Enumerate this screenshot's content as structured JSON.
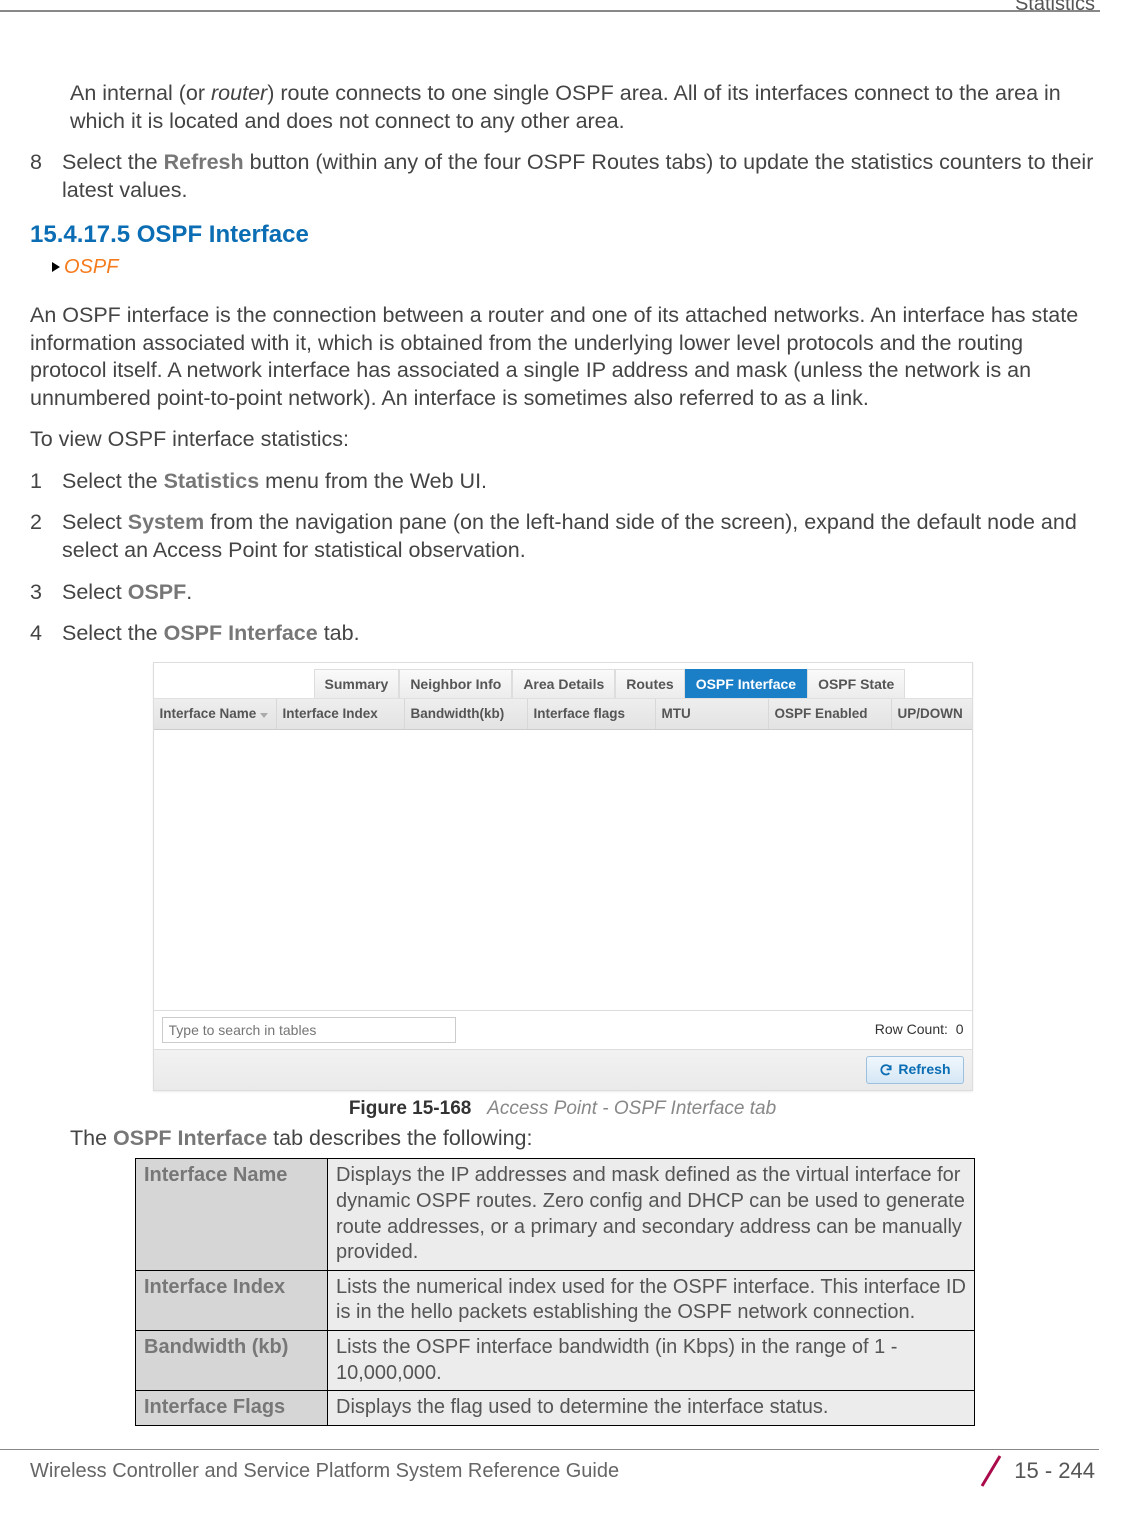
{
  "header": {
    "section": "Statistics"
  },
  "intro": {
    "p1": "An internal (or router) route connects to one single OSPF area. All of its interfaces connect to the area in which it is located and does not connect to any other area."
  },
  "step8": {
    "n": "8",
    "pre": "Select the ",
    "btn": "Refresh",
    "post": " button (within any of the four OSPF Routes tabs) to update the statistics counters to their latest values."
  },
  "h2": "15.4.17.5  OSPF Interface",
  "crumb": "OSPF",
  "p2": "An OSPF interface is the connection between a router and one of its attached networks. An interface has state information associated with it, which is obtained from the underlying lower level protocols and the routing protocol itself. A network interface has associated a single IP address and mask (unless the network is an unnumbered point-to-point network). An interface is sometimes also referred to as a link.",
  "p3": "To view OSPF interface statistics:",
  "steps": {
    "s1": {
      "n": "1",
      "pre": "Select the ",
      "bold": "Statistics",
      "post": " menu from the Web UI."
    },
    "s2": {
      "n": "2",
      "pre": "Select ",
      "bold": "System",
      "post": " from the navigation pane (on the left-hand side of the screen), expand the default node and select an Access Point for statistical observation."
    },
    "s3": {
      "n": "3",
      "pre": "Select ",
      "bold": "OSPF",
      "post": "."
    },
    "s4": {
      "n": "4",
      "pre": "Select the ",
      "bold": "OSPF Interface",
      "post": " tab."
    }
  },
  "tabs": [
    "Summary",
    "Neighbor Info",
    "Area Details",
    "Routes",
    "OSPF Interface",
    "OSPF State"
  ],
  "activeTabIndex": 4,
  "columns": [
    "Interface Name",
    "Interface Index",
    "Bandwidth(kb)",
    "Interface flags",
    "MTU",
    "OSPF Enabled",
    "UP/DOWN"
  ],
  "search_placeholder": "Type to search in tables",
  "row_count_label": "Row Count:",
  "row_count_value": "0",
  "refresh_label": "Refresh",
  "figure": {
    "num": "Figure 15-168",
    "caption": "Access Point - OSPF Interface tab"
  },
  "desc_intro_pre": "The ",
  "desc_intro_bold": "OSPF Interface",
  "desc_intro_post": " tab describes the following:",
  "dtable": [
    {
      "k": "Interface Name",
      "v": "Displays the IP addresses and mask defined as the virtual interface for dynamic OSPF routes. Zero config and DHCP can be used to generate route addresses, or a primary and secondary address can be manually provided."
    },
    {
      "k": "Interface Index",
      "v": "Lists the numerical index used for the OSPF interface. This interface ID is in the hello packets establishing the OSPF network connection."
    },
    {
      "k": "Bandwidth (kb)",
      "v": "Lists the OSPF interface bandwidth (in Kbps) in the range of 1 - 10,000,000."
    },
    {
      "k": "Interface Flags",
      "v": "Displays the flag used to determine the interface status."
    }
  ],
  "footer": {
    "title": "Wireless Controller and Service Platform System Reference Guide",
    "page": "15 - 244"
  }
}
